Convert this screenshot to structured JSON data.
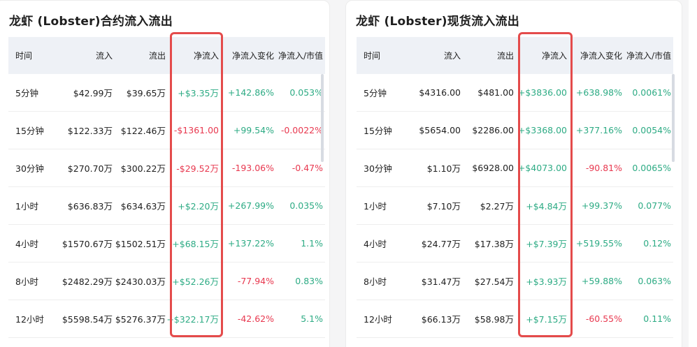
{
  "panels": [
    {
      "title": "龙虾 (Lobster)合约流入流出",
      "columns": [
        "时间",
        "流入",
        "流出",
        "净流入",
        "净流入变化",
        "净流入/市值"
      ],
      "rows": [
        {
          "time": "5分钟",
          "inflow": "$42.99万",
          "outflow": "$39.65万",
          "net": "+$3.35万",
          "change": "+142.86%",
          "ratio": "0.053%"
        },
        {
          "time": "15分钟",
          "inflow": "$122.33万",
          "outflow": "$122.46万",
          "net": "-$1361.00",
          "change": "+99.54%",
          "ratio": "-0.0022%"
        },
        {
          "time": "30分钟",
          "inflow": "$270.70万",
          "outflow": "$300.22万",
          "net": "-$29.52万",
          "change": "-193.06%",
          "ratio": "-0.47%"
        },
        {
          "time": "1小时",
          "inflow": "$636.83万",
          "outflow": "$634.63万",
          "net": "+$2.20万",
          "change": "+267.99%",
          "ratio": "0.035%"
        },
        {
          "time": "4小时",
          "inflow": "$1570.67万",
          "outflow": "$1502.51万",
          "net": "+$68.15万",
          "change": "+137.22%",
          "ratio": "1.1%"
        },
        {
          "time": "8小时",
          "inflow": "$2482.29万",
          "outflow": "$2430.03万",
          "net": "+$52.26万",
          "change": "-77.94%",
          "ratio": "0.83%"
        },
        {
          "time": "12小时",
          "inflow": "$5598.54万",
          "outflow": "$5276.37万",
          "net": "+$322.17万",
          "change": "-42.62%",
          "ratio": "5.1%"
        }
      ]
    },
    {
      "title": "龙虾 (Lobster)现货流入流出",
      "columns": [
        "时间",
        "流入",
        "流出",
        "净流入",
        "净流入变化",
        "净流入/市值"
      ],
      "rows": [
        {
          "time": "5分钟",
          "inflow": "$4316.00",
          "outflow": "$481.00",
          "net": "+$3836.00",
          "change": "+638.98%",
          "ratio": "0.0061%"
        },
        {
          "time": "15分钟",
          "inflow": "$5654.00",
          "outflow": "$2286.00",
          "net": "+$3368.00",
          "change": "+377.16%",
          "ratio": "0.0054%"
        },
        {
          "time": "30分钟",
          "inflow": "$1.10万",
          "outflow": "$6928.00",
          "net": "+$4073.00",
          "change": "-90.81%",
          "ratio": "0.0065%"
        },
        {
          "time": "1小时",
          "inflow": "$7.10万",
          "outflow": "$2.27万",
          "net": "+$4.84万",
          "change": "+99.37%",
          "ratio": "0.077%"
        },
        {
          "time": "4小时",
          "inflow": "$24.77万",
          "outflow": "$17.38万",
          "net": "+$7.39万",
          "change": "+519.55%",
          "ratio": "0.12%"
        },
        {
          "time": "8小时",
          "inflow": "$31.47万",
          "outflow": "$27.54万",
          "net": "+$3.93万",
          "change": "+59.88%",
          "ratio": "0.063%"
        },
        {
          "time": "12小时",
          "inflow": "$66.13万",
          "outflow": "$58.98万",
          "net": "+$7.15万",
          "change": "-60.55%",
          "ratio": "0.11%"
        }
      ]
    }
  ],
  "colors": {
    "positive": "#2dab84",
    "negative": "#e8384f",
    "highlight_border": "#e44b4b",
    "header_bg": "#eef1f6"
  }
}
